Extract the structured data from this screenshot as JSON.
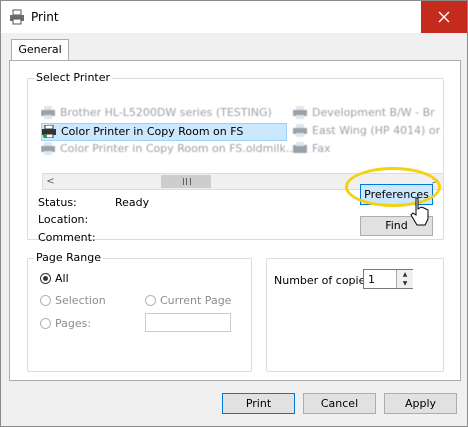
{
  "window": {
    "title": "Print"
  },
  "tabs": [
    {
      "label": "General"
    }
  ],
  "select_printer": {
    "label": "Select Printer",
    "printers": [
      {
        "label": "Brother HL-L5200DW series (TESTING)"
      },
      {
        "label": "Development B/W - Br"
      },
      {
        "label": "Color Printer in Copy Room on FS"
      },
      {
        "label": "East Wing (HP 4014) or"
      },
      {
        "label": "Color Printer in Copy Room on FS.oldmilk..."
      },
      {
        "label": "Fax"
      }
    ],
    "scroll_left": "<",
    "scroll_right": ">",
    "status_label": "Status:",
    "status_value": "Ready",
    "location_label": "Location:",
    "comment_label": "Comment:",
    "preferences_label": "Preferences",
    "find_printer_label": "Find Printer..."
  },
  "page_range": {
    "label": "Page Range",
    "all_label": "All",
    "selection_label": "Selection",
    "current_page_label": "Current Page",
    "pages_label": "Pages:"
  },
  "copies": {
    "label": "Number of copies:",
    "value": "1"
  },
  "buttons": {
    "print": "Print",
    "cancel": "Cancel",
    "apply": "Apply"
  },
  "colors": {
    "close": "#c42b1c",
    "highlight": "#f4d20f",
    "selected": "#cce8ff",
    "accent": "#0078d7"
  }
}
